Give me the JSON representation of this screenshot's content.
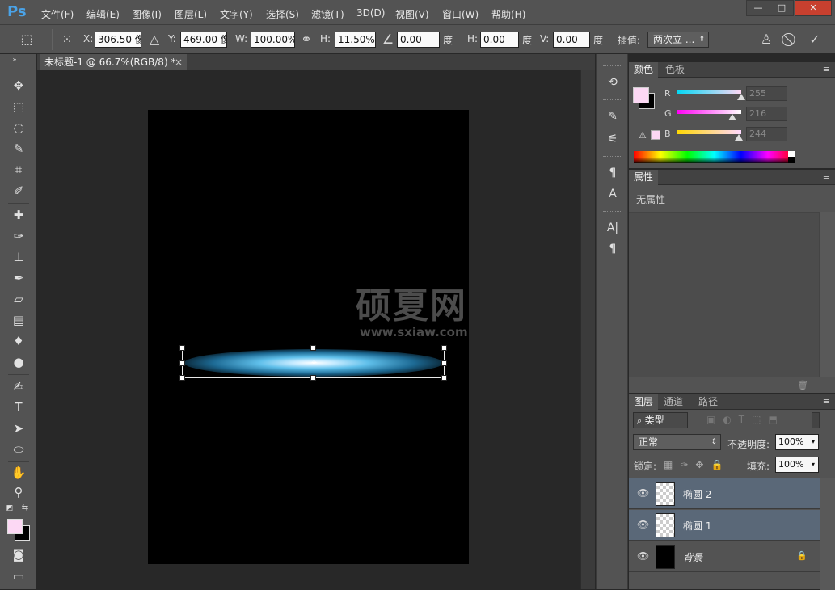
{
  "app": {
    "logo": "Ps"
  },
  "menu": [
    "文件(F)",
    "编辑(E)",
    "图像(I)",
    "图层(L)",
    "文字(Y)",
    "选择(S)",
    "滤镜(T)",
    "3D(D)",
    "视图(V)",
    "窗口(W)",
    "帮助(H)"
  ],
  "window_controls": {
    "minimize": "—",
    "maximize": "□",
    "close": "✕"
  },
  "options": {
    "x_label": "X:",
    "x_value": "306.50 像",
    "y_label": "Y:",
    "y_value": "469.00 像",
    "w_label": "W:",
    "w_value": "100.00%",
    "h_label": "H:",
    "h_value": "11.50%",
    "angle_value": "0.00",
    "angle_unit": "度",
    "hskew_label": "H:",
    "hskew_value": "0.00",
    "hskew_unit": "度",
    "vskew_label": "V:",
    "vskew_value": "0.00",
    "vskew_unit": "度",
    "interp_label": "插值:",
    "interp_value": "两次立 ..."
  },
  "document": {
    "tab_title": "未标题-1 @ 66.7%(RGB/8) *",
    "tab_close": "×"
  },
  "watermark": {
    "title": "硕夏网",
    "url": "www.sxiaw.com"
  },
  "color_panel": {
    "tabs": [
      "颜色",
      "色板"
    ],
    "channels": [
      {
        "label": "R",
        "value": "255"
      },
      {
        "label": "G",
        "value": "216"
      },
      {
        "label": "B",
        "value": "244"
      }
    ],
    "foreground": "#fcd8f4",
    "background": "#000000"
  },
  "properties_panel": {
    "tab": "属性",
    "empty_text": "无属性"
  },
  "layers_panel": {
    "tabs": [
      "图层",
      "通道",
      "路径"
    ],
    "filter_label": "类型",
    "blend_mode": "正常",
    "opacity_label": "不透明度:",
    "opacity_value": "100%",
    "lock_label": "锁定:",
    "fill_label": "填充:",
    "fill_value": "100%",
    "layers": [
      {
        "name": "椭圆 2",
        "selected": true
      },
      {
        "name": "椭圆 1",
        "selected": true
      },
      {
        "name": "背景",
        "selected": false,
        "locked": true
      }
    ]
  }
}
